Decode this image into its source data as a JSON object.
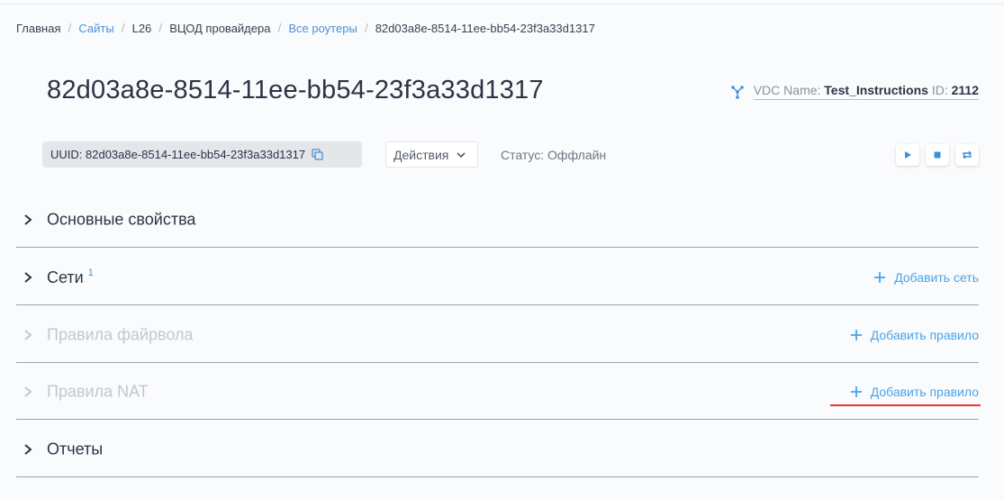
{
  "breadcrumb": {
    "items": [
      "Главная",
      "Сайты",
      "L26",
      "ВЦОД провайдера",
      "Все роутеры",
      "82d03a8e-8514-11ee-bb54-23f3a33d1317"
    ],
    "separator": "/"
  },
  "header": {
    "title": "82d03a8e-8514-11ee-bb54-23f3a33d1317",
    "vdc_name_label": "VDC Name:",
    "vdc_name_value": "Test_Instructions",
    "id_label": "ID:",
    "id_value": "2112"
  },
  "toolbar": {
    "uuid_text": "UUID: 82d03a8e-8514-11ee-bb54-23f3a33d1317",
    "actions_label": "Действия",
    "status_text": "Статус: Оффлайн"
  },
  "sections": {
    "basic": {
      "label": "Основные свойства"
    },
    "networks": {
      "label": "Сети",
      "count": "1",
      "add_label": "Добавить сеть"
    },
    "firewall": {
      "label": "Правила файрвола",
      "add_label": "Добавить правило"
    },
    "nat": {
      "label": "Правила NAT",
      "add_label": "Добавить правило"
    },
    "reports": {
      "label": "Отчеты"
    }
  },
  "icons": {
    "network": "network-topology-icon",
    "copy": "copy-icon",
    "dropdown": "chevron-down-icon",
    "play": "play-icon",
    "stop": "stop-icon",
    "restart": "restart-icon",
    "expand": "chevron-right-icon",
    "add": "plus-icon"
  },
  "colors": {
    "accent": "#4aa3e8",
    "link": "#4a90d9",
    "highlight": "#e53935",
    "disabled_text": "#c3c7ce"
  }
}
